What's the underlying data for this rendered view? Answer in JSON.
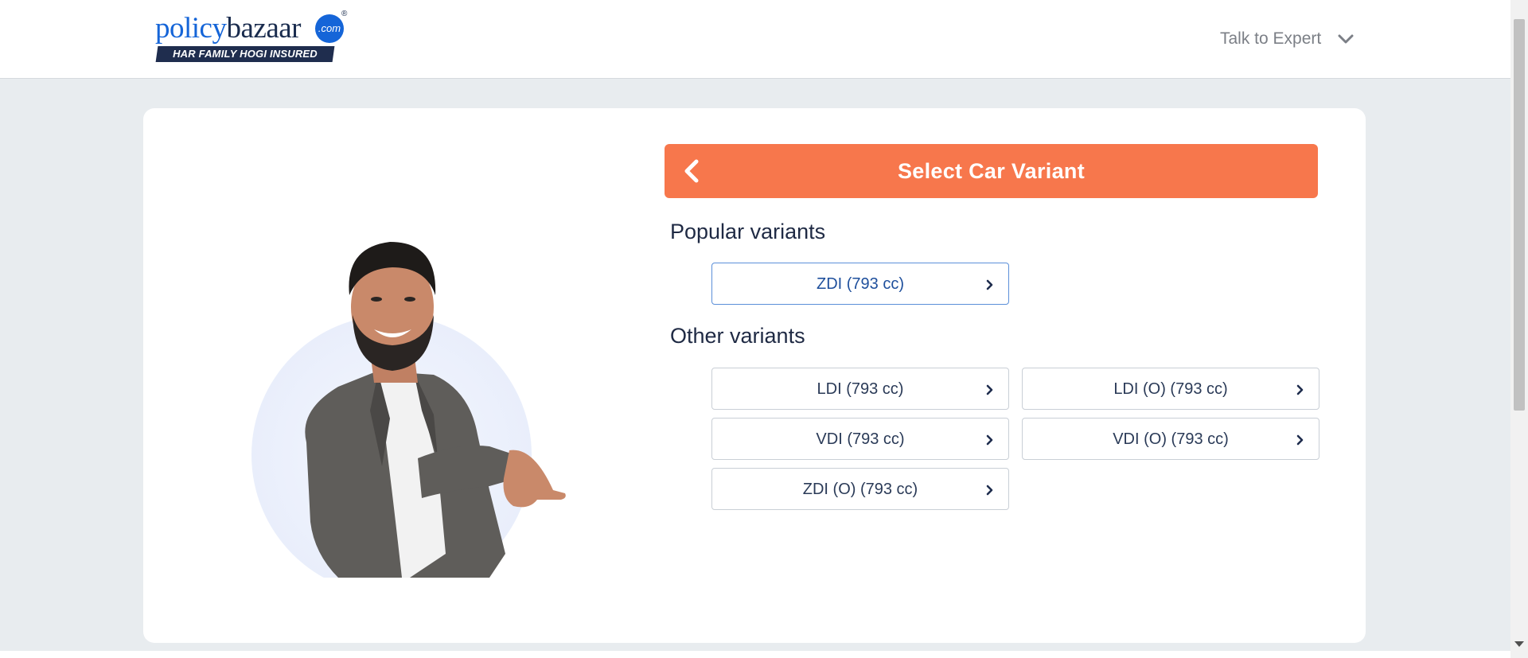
{
  "header": {
    "logo": {
      "word_policy": "policy",
      "word_bazaar": "bazaar",
      "com": ".com",
      "registered": "®",
      "tagline": "HAR FAMILY HOGI INSURED"
    },
    "talk_to_expert": "Talk to Expert"
  },
  "panel": {
    "title": "Select Car Variant",
    "popular_heading": "Popular variants",
    "popular": [
      {
        "label": "ZDI (793 cc)"
      }
    ],
    "other_heading": "Other variants",
    "other": [
      {
        "label": "LDI (793 cc)"
      },
      {
        "label": "LDI (O) (793 cc)"
      },
      {
        "label": "VDI (793 cc)"
      },
      {
        "label": "VDI (O) (793 cc)"
      },
      {
        "label": "ZDI (O) (793 cc)"
      }
    ]
  },
  "colors": {
    "accent": "#f7774c",
    "brand_blue": "#1565d8",
    "brand_navy": "#1f2d4e"
  },
  "icons": {
    "back": "chevron-left-icon",
    "dropdown": "chevron-down-icon",
    "variant_arrow": "chevron-right-icon"
  }
}
